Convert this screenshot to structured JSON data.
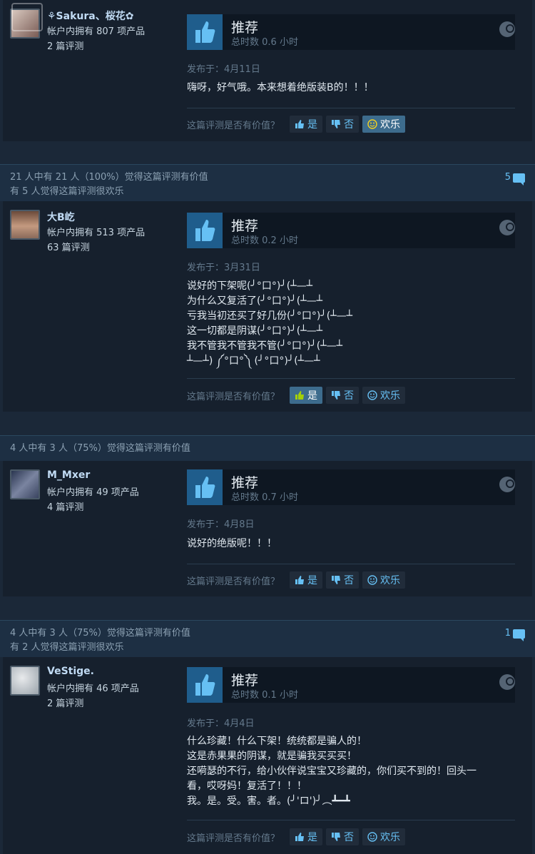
{
  "ui": {
    "helpful_question": "这篇评测是否有价值？",
    "yes_label": "是",
    "no_label": "否",
    "funny_label": "欢乐"
  },
  "reviews": [
    {
      "header_line1": "",
      "header_line2": "",
      "comment_count": "",
      "author": {
        "name": "⚘Sakura、桜花✿",
        "products": "帐户内拥有 807 项产品",
        "reviews": "2 篇评测"
      },
      "verdict": "推荐",
      "hours": "总时数 0.6 小时",
      "posted": "发布于：4月11日",
      "text": "嗨呀，好气哦。本来想着绝版装B的！！！",
      "active_vote": "funny"
    },
    {
      "header_line1": "21 人中有 21 人（100%）觉得这篇评测有价值",
      "header_line2": "有 5 人觉得这篇评测很欢乐",
      "comment_count": "5",
      "author": {
        "name": "大B屹",
        "products": "帐户内拥有 513 项产品",
        "reviews": "63 篇评测"
      },
      "verdict": "推荐",
      "hours": "总时数 0.2 小时",
      "posted": "发布于：3月31日",
      "text": "说好的下架呢(╯°口°)╯(┴—┴\n为什么又复活了(╯°口°)╯(┴—┴\n亏我当初还买了好几份(╯°口°)╯(┴—┴\n这一切都是阴谋(╯°口°)╯(┴—┴\n我不管我不管我不管(╯°口°)╯(┴—┴\n┴—┴) ༼°口°༽ (╯°口°)╯(┴—┴",
      "active_vote": "yes"
    },
    {
      "header_line1": "4 人中有 3 人（75%）觉得这篇评测有价值",
      "header_line2": "",
      "comment_count": "",
      "author": {
        "name": "M_Mxer",
        "products": "帐户内拥有 49 项产品",
        "reviews": "4 篇评测"
      },
      "verdict": "推荐",
      "hours": "总时数 0.7 小时",
      "posted": "发布于：4月8日",
      "text": "说好的绝版呢！！！",
      "active_vote": ""
    },
    {
      "header_line1": "4 人中有 3 人（75%）觉得这篇评测有价值",
      "header_line2": "有 2 人觉得这篇评测很欢乐",
      "comment_count": "1",
      "author": {
        "name": "VeStige.",
        "products": "帐户内拥有 46 项产品",
        "reviews": "2 篇评测"
      },
      "verdict": "推荐",
      "hours": "总时数 0.1 小时",
      "posted": "发布于：4月4日",
      "text": "什么珍藏！什么下架！统统都是骗人的！\n这是赤果果的阴谋，就是骗我买买买！\n还嗬瑟的不行，给小伙伴说宝宝又珍藏的，你们买不到的！回头一\n看，哎呀妈！复活了！！！\n我。是。受。害。者。(╯'ロ')╯︵┻━┻",
      "active_vote": ""
    }
  ],
  "colors": {
    "background": "#1b2838",
    "panel": "#16202d",
    "accent": "#66c0f4",
    "thumb": "#1f5d8c"
  },
  "icons": [
    "thumbs-up-icon",
    "steam-logo-icon",
    "comment-icon",
    "vote-up-icon",
    "vote-down-icon",
    "smile-icon"
  ]
}
